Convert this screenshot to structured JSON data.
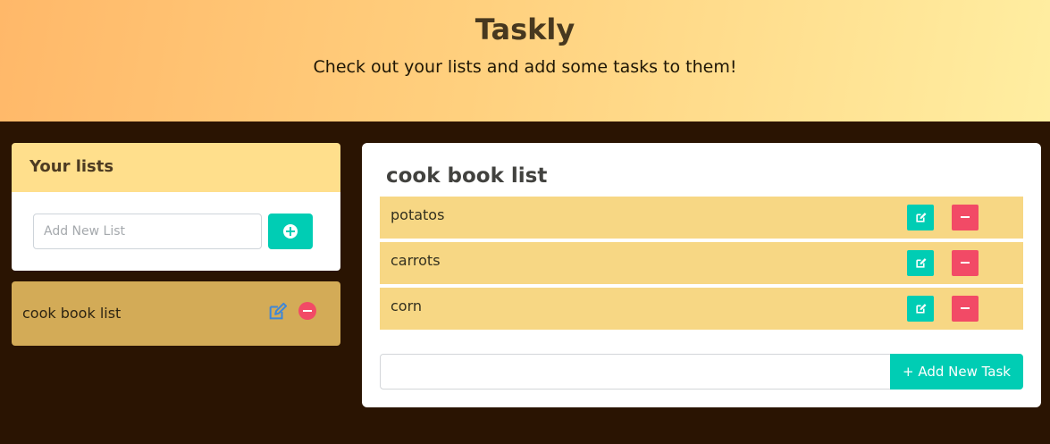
{
  "header": {
    "title": "Taskly",
    "subtitle": "Check out your lists and add some tasks to them!"
  },
  "lists_panel": {
    "heading": "Your lists",
    "new_list_placeholder": "Add New List",
    "new_list_value": "",
    "add_button_icon": "plus-circle-icon",
    "lists": [
      {
        "name": "cook book list",
        "edit_icon": "pencil-square-icon",
        "remove_icon": "minus-circle-icon"
      }
    ]
  },
  "tasks_panel": {
    "list_title": "cook book list",
    "tasks": [
      {
        "label": "potatos"
      },
      {
        "label": "carrots"
      },
      {
        "label": "corn"
      }
    ],
    "new_task_value": "",
    "add_task_label": "+ Add New Task"
  },
  "colors": {
    "accent_teal": "#00cdb4",
    "danger_red": "#f24a66",
    "background_dark": "#2a1402",
    "task_row": "#f7d784",
    "list_item": "#d3ab57"
  }
}
